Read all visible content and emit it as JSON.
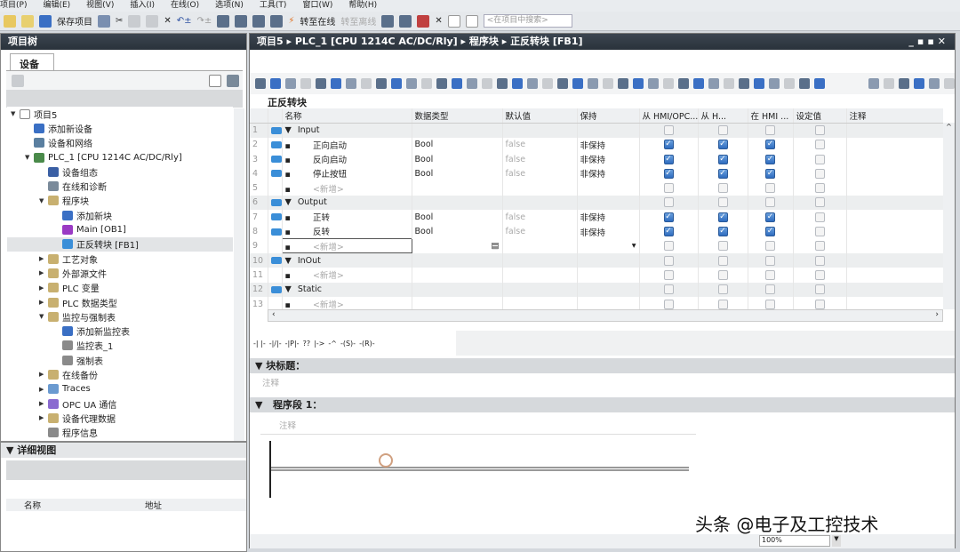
{
  "menu": [
    "项目(P)",
    "编辑(E)",
    "视图(V)",
    "插入(I)",
    "在线(O)",
    "选项(N)",
    "工具(T)",
    "窗口(W)",
    "帮助(H)"
  ],
  "toolbar": {
    "save": "保存项目",
    "go_online": "转至在线",
    "go_offline": "转至离线",
    "search_placeholder": "<在项目中搜索>"
  },
  "project_tree": {
    "title": "项目树",
    "tab": "设备",
    "items": [
      {
        "label": "项目5",
        "level": 0,
        "arrow": "▼",
        "color": "#ffffff"
      },
      {
        "label": "添加新设备",
        "level": 1,
        "arrow": "",
        "color": "#3a6fc4"
      },
      {
        "label": "设备和网络",
        "level": 1,
        "arrow": "",
        "color": "#5a7fa0"
      },
      {
        "label": "PLC_1 [CPU 1214C AC/DC/Rly]",
        "level": 1,
        "arrow": "▼",
        "color": "#4a8a4a"
      },
      {
        "label": "设备组态",
        "level": 2,
        "arrow": "",
        "color": "#3a5fa4"
      },
      {
        "label": "在线和诊断",
        "level": 2,
        "arrow": "",
        "color": "#7a8a9a"
      },
      {
        "label": "程序块",
        "level": 2,
        "arrow": "▼",
        "color": "#c8b070"
      },
      {
        "label": "添加新块",
        "level": 3,
        "arrow": "",
        "color": "#3a6fc4"
      },
      {
        "label": "Main [OB1]",
        "level": 3,
        "arrow": "",
        "color": "#9a3ac4"
      },
      {
        "label": "正反转块 [FB1]",
        "level": 3,
        "arrow": "",
        "color": "#3a8ed8",
        "selected": true
      },
      {
        "label": "工艺对象",
        "level": 2,
        "arrow": "▶",
        "color": "#c8b070"
      },
      {
        "label": "外部源文件",
        "level": 2,
        "arrow": "▶",
        "color": "#c8b070"
      },
      {
        "label": "PLC 变量",
        "level": 2,
        "arrow": "▶",
        "color": "#c8b070"
      },
      {
        "label": "PLC 数据类型",
        "level": 2,
        "arrow": "▶",
        "color": "#c8b070"
      },
      {
        "label": "监控与强制表",
        "level": 2,
        "arrow": "▼",
        "color": "#c8b070"
      },
      {
        "label": "添加新监控表",
        "level": 3,
        "arrow": "",
        "color": "#3a6fc4"
      },
      {
        "label": "监控表_1",
        "level": 3,
        "arrow": "",
        "color": "#8a8a8a"
      },
      {
        "label": "强制表",
        "level": 3,
        "arrow": "",
        "color": "#8a8a8a"
      },
      {
        "label": "在线备份",
        "level": 2,
        "arrow": "▶",
        "color": "#c8b070"
      },
      {
        "label": "Traces",
        "level": 2,
        "arrow": "▶",
        "color": "#6a9ad0"
      },
      {
        "label": "OPC UA 通信",
        "level": 2,
        "arrow": "▶",
        "color": "#8a6ad0"
      },
      {
        "label": "设备代理数据",
        "level": 2,
        "arrow": "▶",
        "color": "#c8b070"
      },
      {
        "label": "程序信息",
        "level": 2,
        "arrow": "",
        "color": "#8a8a8a"
      }
    ]
  },
  "detail_view": {
    "title": "详细视图",
    "columns": [
      "名称",
      "地址"
    ]
  },
  "editor": {
    "breadcrumb": [
      "项目5",
      "PLC_1 [CPU 1214C AC/DC/Rly]",
      "程序块",
      "正反转块 [FB1]"
    ],
    "block_name": "正反转块",
    "columns": [
      "名称",
      "数据类型",
      "默认值",
      "保持",
      "从 HMI/OPC...",
      "从 H...",
      "在 HMI ...",
      "设定值",
      "注释"
    ],
    "rows": [
      {
        "n": "1",
        "name": "Input",
        "section": true
      },
      {
        "n": "2",
        "name": "正向启动",
        "type": "Bool",
        "default": "false",
        "retain": "非保持",
        "checks": [
          true,
          true,
          true,
          false
        ]
      },
      {
        "n": "3",
        "name": "反向启动",
        "type": "Bool",
        "default": "false",
        "retain": "非保持",
        "checks": [
          true,
          true,
          true,
          false
        ]
      },
      {
        "n": "4",
        "name": "停止按钮",
        "type": "Bool",
        "default": "false",
        "retain": "非保持",
        "checks": [
          true,
          true,
          true,
          false
        ]
      },
      {
        "n": "5",
        "name": "<新增>",
        "placeholder": true
      },
      {
        "n": "6",
        "name": "Output",
        "section": true
      },
      {
        "n": "7",
        "name": "正转",
        "type": "Bool",
        "default": "false",
        "retain": "非保持",
        "checks": [
          true,
          true,
          true,
          false
        ]
      },
      {
        "n": "8",
        "name": "反转",
        "type": "Bool",
        "default": "false",
        "retain": "非保持",
        "checks": [
          true,
          true,
          true,
          false
        ]
      },
      {
        "n": "9",
        "name": "<新增>",
        "placeholder": true,
        "editing": true
      },
      {
        "n": "10",
        "name": "InOut",
        "section": true
      },
      {
        "n": "11",
        "name": "<新增>",
        "placeholder": true
      },
      {
        "n": "12",
        "name": "Static",
        "section": true
      },
      {
        "n": "13",
        "name": "<新增>",
        "placeholder": true
      }
    ],
    "ladder_tools": [
      "-| |-",
      "-|/|-",
      "-|P|-",
      "??",
      "|->",
      "-^",
      "-(S)-",
      "-(R)-"
    ],
    "block_title_label": "块标题：",
    "comment": "注释",
    "network_label": "程序段 1：",
    "network_comment": "注释",
    "zoom": "100%"
  },
  "watermark": "头条 @电子及工控技术"
}
